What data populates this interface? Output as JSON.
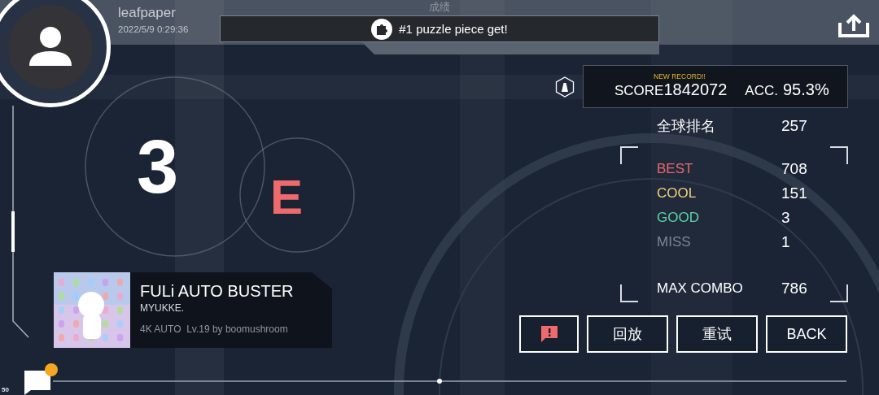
{
  "header": {
    "title": "成绩",
    "username": "leafpaper",
    "datetime": "2022/5/9 0:29:36"
  },
  "toast": {
    "text": "#1 puzzle piece get!"
  },
  "result": {
    "grade": "3",
    "judge_mode": "E"
  },
  "score_panel": {
    "badge": "NEW RECORD!!",
    "score_label": "SCORE",
    "score": "1842072",
    "acc_label": "ACC.",
    "acc": "95.3%"
  },
  "rank": {
    "label": "全球排名",
    "value": "257"
  },
  "judgements": [
    {
      "label": "BEST",
      "value": "708",
      "color": "#e8686e"
    },
    {
      "label": "COOL",
      "value": "151",
      "color": "#f0d27a"
    },
    {
      "label": "GOOD",
      "value": "3",
      "color": "#5ed3a8"
    },
    {
      "label": "MISS",
      "value": "1",
      "color": "#7d8590"
    }
  ],
  "max_combo": {
    "label": "MAX COMBO",
    "value": "786"
  },
  "song": {
    "title": "FULi AUTO BUSTER",
    "artist": "MYUKKE.",
    "mode": "4K AUTO",
    "chart": "Lv.19 by boomushroom"
  },
  "buttons": [
    {
      "kind": "report"
    },
    {
      "kind": "text",
      "label": "回放"
    },
    {
      "kind": "text",
      "label": "重试"
    },
    {
      "kind": "text",
      "label": "BACK"
    }
  ],
  "chat": {
    "unread": true
  },
  "corner_label": "50"
}
